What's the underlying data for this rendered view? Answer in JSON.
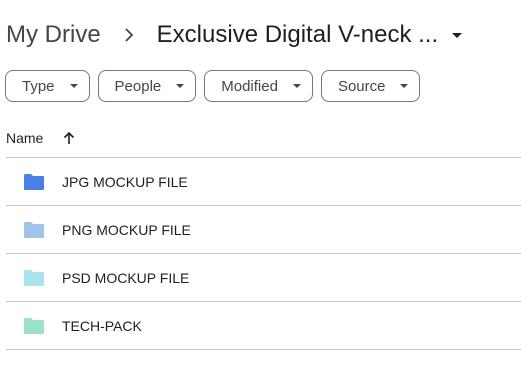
{
  "breadcrumb": {
    "root": "My Drive",
    "current": "Exclusive Digital V-neck ..."
  },
  "filters": [
    {
      "label": "Type"
    },
    {
      "label": "People"
    },
    {
      "label": "Modified"
    },
    {
      "label": "Source"
    }
  ],
  "table": {
    "name_header": "Name",
    "sort": "ascending"
  },
  "files": [
    {
      "name": "JPG MOCKUP FILE",
      "icon": "folder-icon",
      "color": "#4a7fe5"
    },
    {
      "name": "PNG MOCKUP FILE",
      "icon": "folder-icon",
      "color": "#a0c3ea"
    },
    {
      "name": "PSD MOCKUP FILE",
      "icon": "folder-icon",
      "color": "#a8e4ea"
    },
    {
      "name": "TECH-PACK",
      "icon": "folder-icon",
      "color": "#9de1c8"
    }
  ]
}
